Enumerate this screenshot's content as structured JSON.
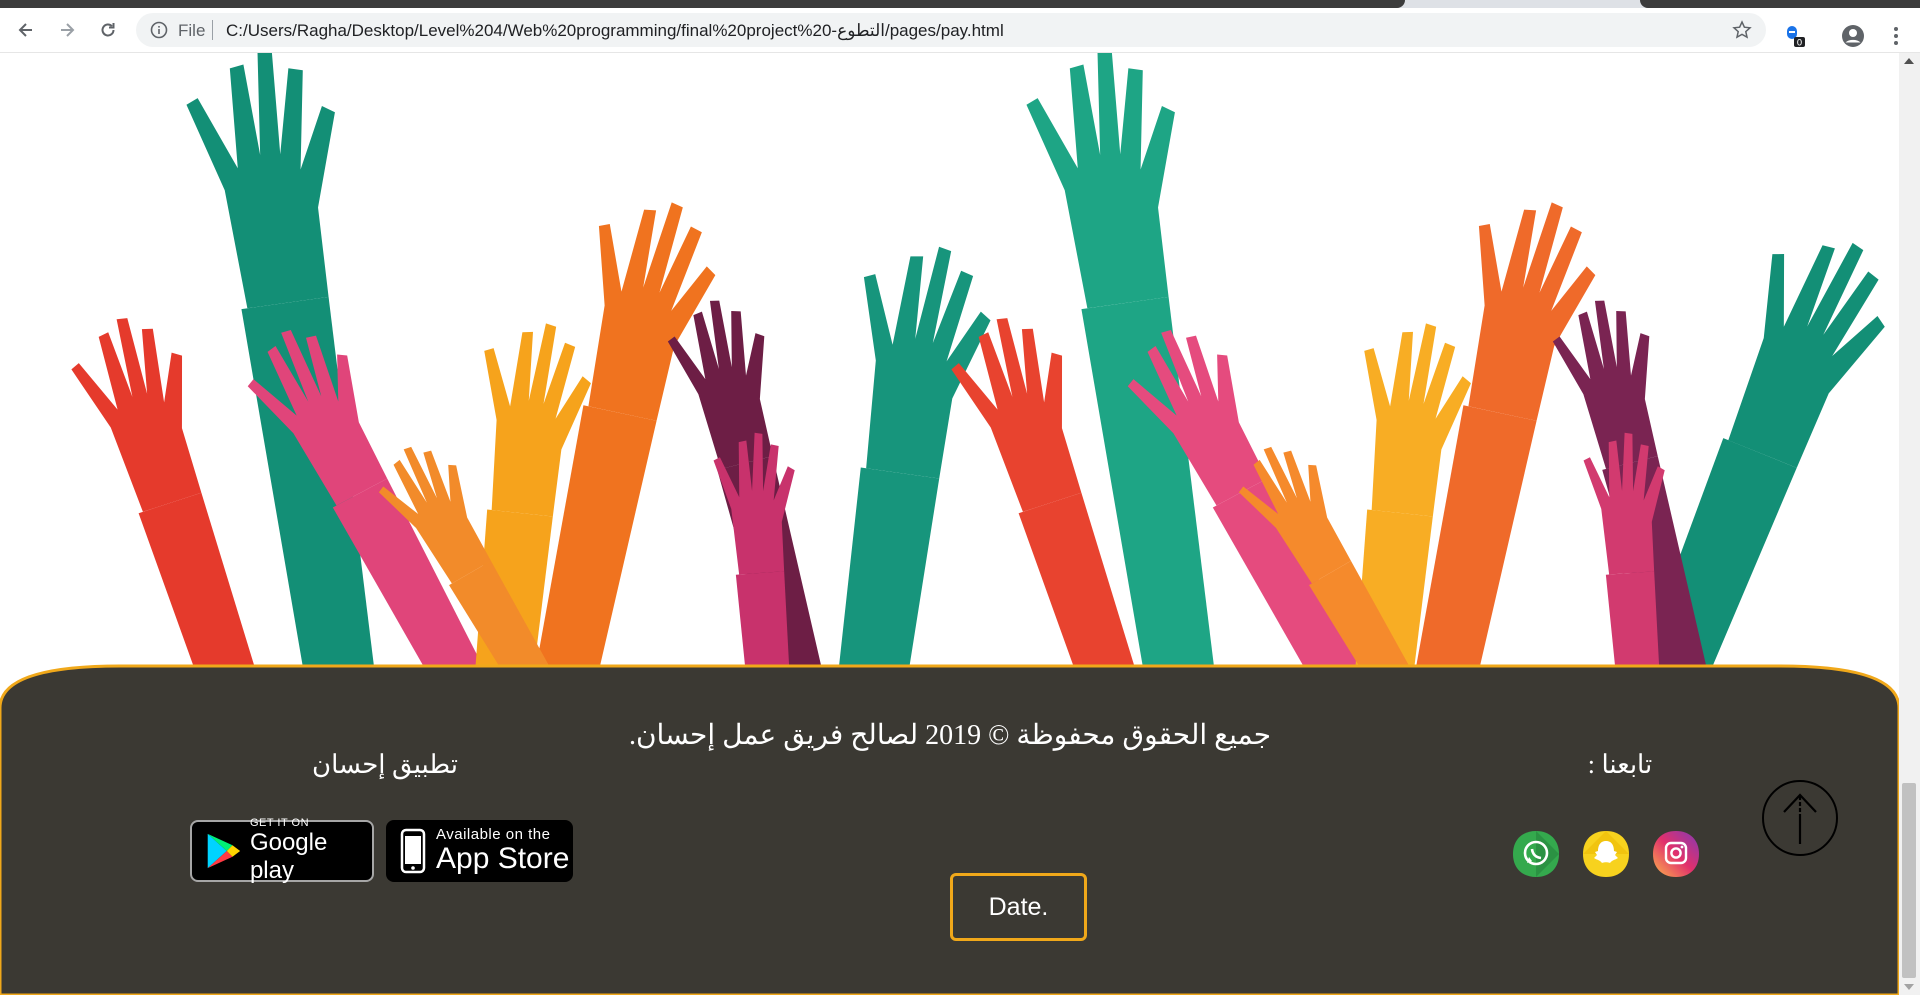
{
  "browser": {
    "file_label": "File",
    "url": "C:/Users/Ragha/Desktop/Level%204/Web%20programming/final%20project%20-التطوع/pages/pay.html",
    "extension_badge": "0"
  },
  "footer": {
    "copyright": "جميع الحقوق محفوظة © 2019 لصالح فريق عمل إحسان.",
    "app_title": "تطبيق إحسان",
    "follow_title": "تابعنا :",
    "google_play": {
      "small": "GET IT ON",
      "big": "Google play"
    },
    "app_store": {
      "small": "Available on the",
      "big": "App Store"
    },
    "date_button": "Date.",
    "social": [
      "whatsapp-icon",
      "snapchat-icon",
      "instagram-icon"
    ]
  },
  "colors": {
    "footer_bg": "#3b3933",
    "footer_border": "#f0a81a",
    "hand_teal": "#138f76",
    "hand_orange": "#f0731f",
    "hand_red": "#e53a2c",
    "hand_pink": "#e0457a",
    "hand_yellow": "#f6a31c",
    "hand_purple": "#6d1e45"
  }
}
